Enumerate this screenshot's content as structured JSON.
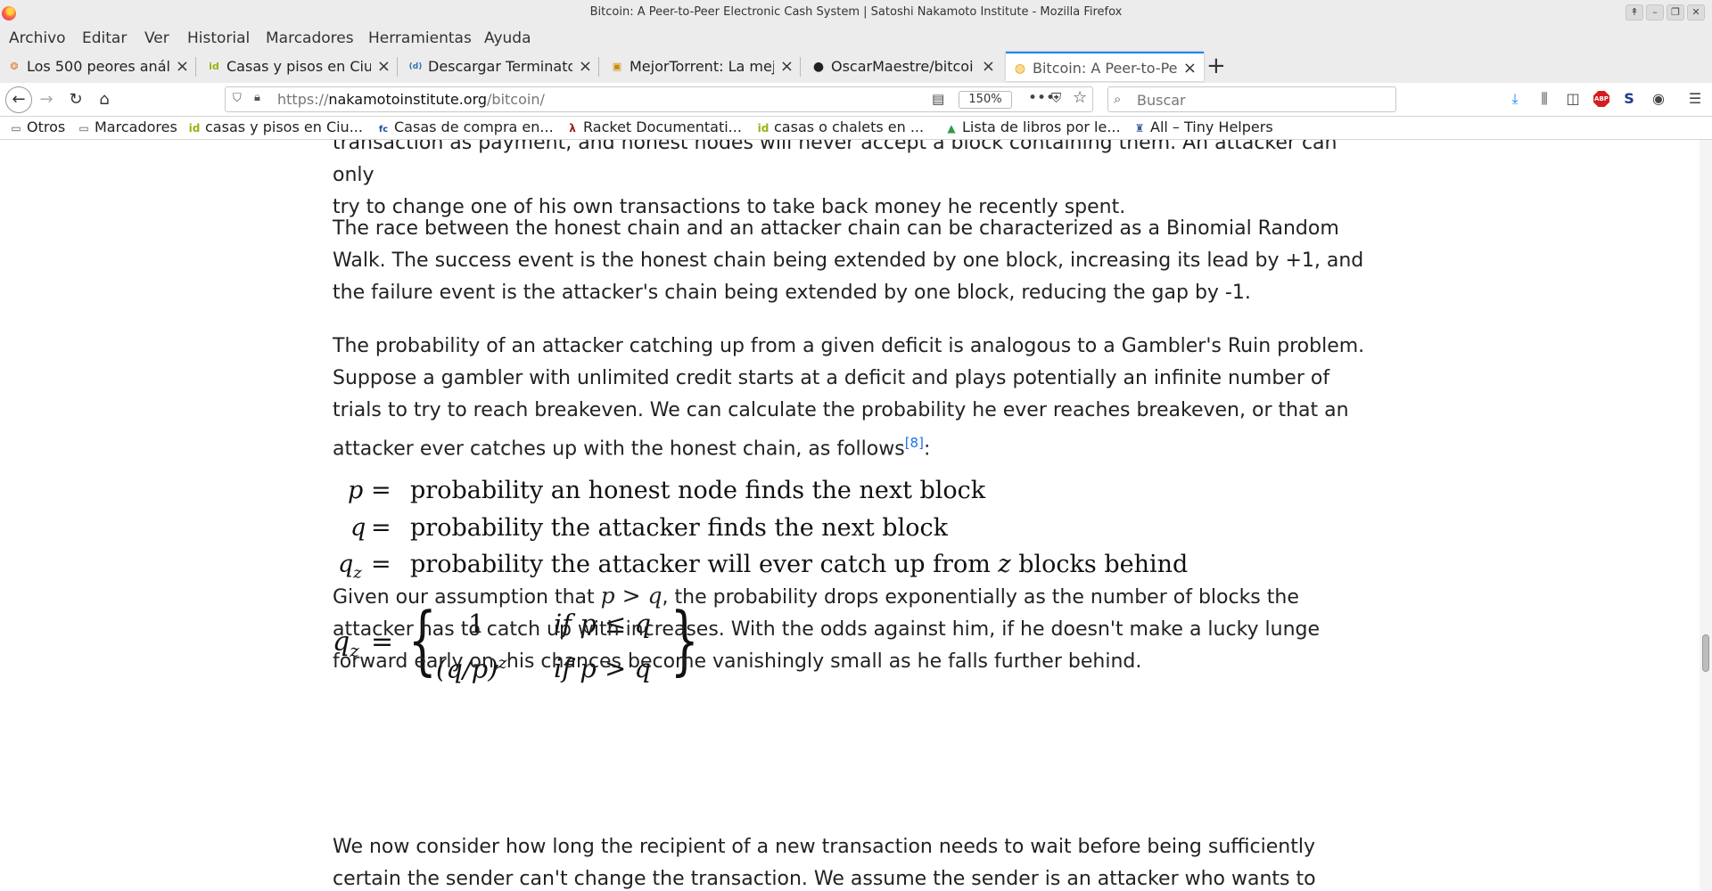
{
  "window": {
    "title": "Bitcoin: A Peer-to-Peer Electronic Cash System | Satoshi Nakamoto Institute - Mozilla Firefox",
    "buttons": [
      "↟",
      "–",
      "❐",
      "✕"
    ]
  },
  "menu": [
    "Archivo",
    "Editar",
    "Ver",
    "Historial",
    "Marcadores",
    "Herramientas",
    "Ayuda"
  ],
  "tabs": [
    {
      "title": "Los 500 peores anál",
      "icon": "flame-icon",
      "icon_text": "❂",
      "icon_color": "#e07b3a"
    },
    {
      "title": "Casas y pisos en Ciu",
      "icon": "idealista-icon",
      "icon_text": "id",
      "icon_color": "#98b414"
    },
    {
      "title": "Descargar Terminato",
      "icon": "torrent-site-icon",
      "icon_text": "(d)",
      "icon_color": "#3a6fb0"
    },
    {
      "title": "MejorTorrent: La mej",
      "icon": "mejortorrent-icon",
      "icon_text": "▣",
      "icon_color": "#c98a00"
    },
    {
      "title": "OscarMaestre/bitcoi",
      "icon": "github-icon",
      "icon_text": "●",
      "icon_color": "#222222"
    },
    {
      "title": "Bitcoin: A Peer-to-Pe",
      "icon": "bitcoin-icon",
      "icon_text": "◍",
      "icon_color": "#e8a400"
    }
  ],
  "url": {
    "prefix": "https://",
    "host": "nakamotoinstitute.org",
    "path": "/bitcoin/"
  },
  "zoom": "150%",
  "search": {
    "placeholder": "Buscar"
  },
  "bookmarks": [
    {
      "label": "Otros",
      "icon": "folder-icon",
      "icon_text": "▭"
    },
    {
      "label": "Marcadores",
      "icon": "folder-icon",
      "icon_text": "▭"
    },
    {
      "label": "casas y pisos en Ciu...",
      "icon": "idealista-icon",
      "icon_text": "id"
    },
    {
      "label": "Casas de compra en...",
      "icon": "fotocasa-icon",
      "icon_text": "fc"
    },
    {
      "label": "Racket Documentati...",
      "icon": "racket-icon",
      "icon_text": "λ"
    },
    {
      "label": "casas o chalets en ...",
      "icon": "idealista-icon",
      "icon_text": "id"
    },
    {
      "label": "Lista de libros por le...",
      "icon": "google-drive-icon",
      "icon_text": "▲"
    },
    {
      "label": "All – Tiny Helpers",
      "icon": "tiny-helpers-icon",
      "icon_text": "♜"
    }
  ],
  "article": {
    "p0_line1": "transaction as payment, and honest nodes will never accept a block containing them. An attacker can only",
    "p0_line2": "try to change one of his own transactions to take back money he recently spent.",
    "p1": "The race between the honest chain and an attacker chain can be characterized as a Binomial Random Walk. The success event is the honest chain being extended by one block, increasing its lead by +1, and the failure event is the attacker's chain being extended by one block, reducing the gap by -1.",
    "p2": "The probability of an attacker catching up from a given deficit is analogous to a Gambler's Ruin problem. Suppose a gambler with unlimited credit starts at a deficit and plays potentially an infinite number of trials to try to reach breakeven. We can calculate the probability he ever reaches breakeven, or that an attacker ever catches up with the honest chain, as follows",
    "p2_ref": "[8]",
    "p2_tail": ":",
    "definitions": [
      {
        "symbol": "p",
        "sub": "",
        "eq": "=",
        "text": "probability an honest node finds the next block"
      },
      {
        "symbol": "q",
        "sub": "",
        "eq": "=",
        "text": "probability the attacker finds the next block"
      },
      {
        "symbol": "q",
        "sub": "z",
        "eq": "=",
        "text_before": "probability the attacker will ever catch up from ",
        "text_var": "z",
        "text_after": " blocks behind"
      }
    ],
    "formula": {
      "lhs": "q",
      "lhs_sub": "z",
      "eq": "=",
      "case1_value": "1",
      "case1_cond": "if p ≤ q",
      "case2_value": "(q/p)",
      "case2_exp": "z",
      "case2_cond": "if p > q"
    },
    "p3_before": "Given our assumption that ",
    "p3_math": "p > q",
    "p3_after": ", the probability drops exponentially as the number of blocks the attacker has to catch up with increases. With the odds against him, if he doesn't make a lucky lunge forward early on, his chances become vanishingly small as he falls further behind.",
    "p4": "We now consider how long the recipient of a new transaction needs to wait before being sufficiently certain the sender can't change the transaction. We assume the sender is an attacker who wants to make the"
  }
}
